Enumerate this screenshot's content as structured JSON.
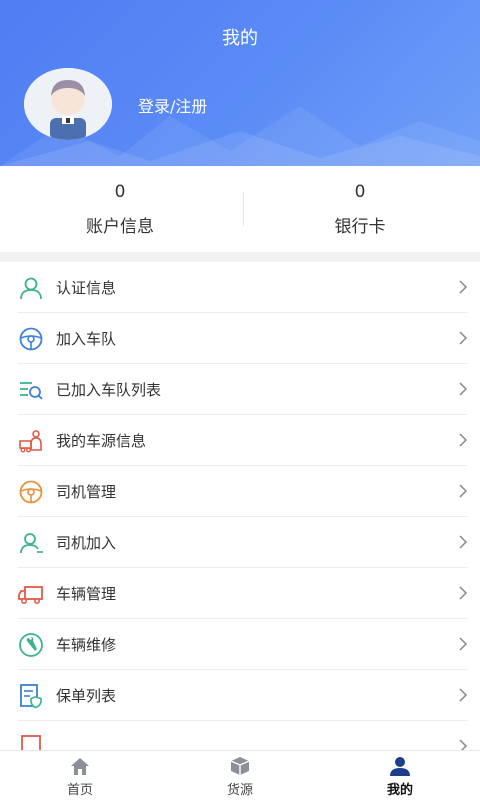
{
  "header": {
    "title": "我的",
    "login_label": "登录/注册"
  },
  "stats": [
    {
      "value": "0",
      "label": "账户信息"
    },
    {
      "value": "0",
      "label": "银行卡"
    }
  ],
  "menu": [
    {
      "label": "认证信息",
      "icon": "user-outline-icon"
    },
    {
      "label": "加入车队",
      "icon": "steering-wheel-icon"
    },
    {
      "label": "已加入车队列表",
      "icon": "list-search-icon"
    },
    {
      "label": "我的车源信息",
      "icon": "truck-person-icon"
    },
    {
      "label": "司机管理",
      "icon": "steering-wheel-orange-icon"
    },
    {
      "label": "司机加入",
      "icon": "user-add-icon"
    },
    {
      "label": "车辆管理",
      "icon": "truck-icon"
    },
    {
      "label": "车辆维修",
      "icon": "wrench-icon"
    },
    {
      "label": "保单列表",
      "icon": "policy-shield-icon"
    }
  ],
  "tabbar": [
    {
      "label": "首页",
      "icon": "home-icon"
    },
    {
      "label": "货源",
      "icon": "box-icon"
    },
    {
      "label": "我的",
      "icon": "person-icon",
      "active": true
    }
  ],
  "colors": {
    "header_bg": "#5b8cf6",
    "green": "#3bb38b",
    "blue": "#3d7fd9",
    "orange": "#e8913a",
    "red": "#e05a47",
    "active_tab": "#1a3e8c"
  }
}
